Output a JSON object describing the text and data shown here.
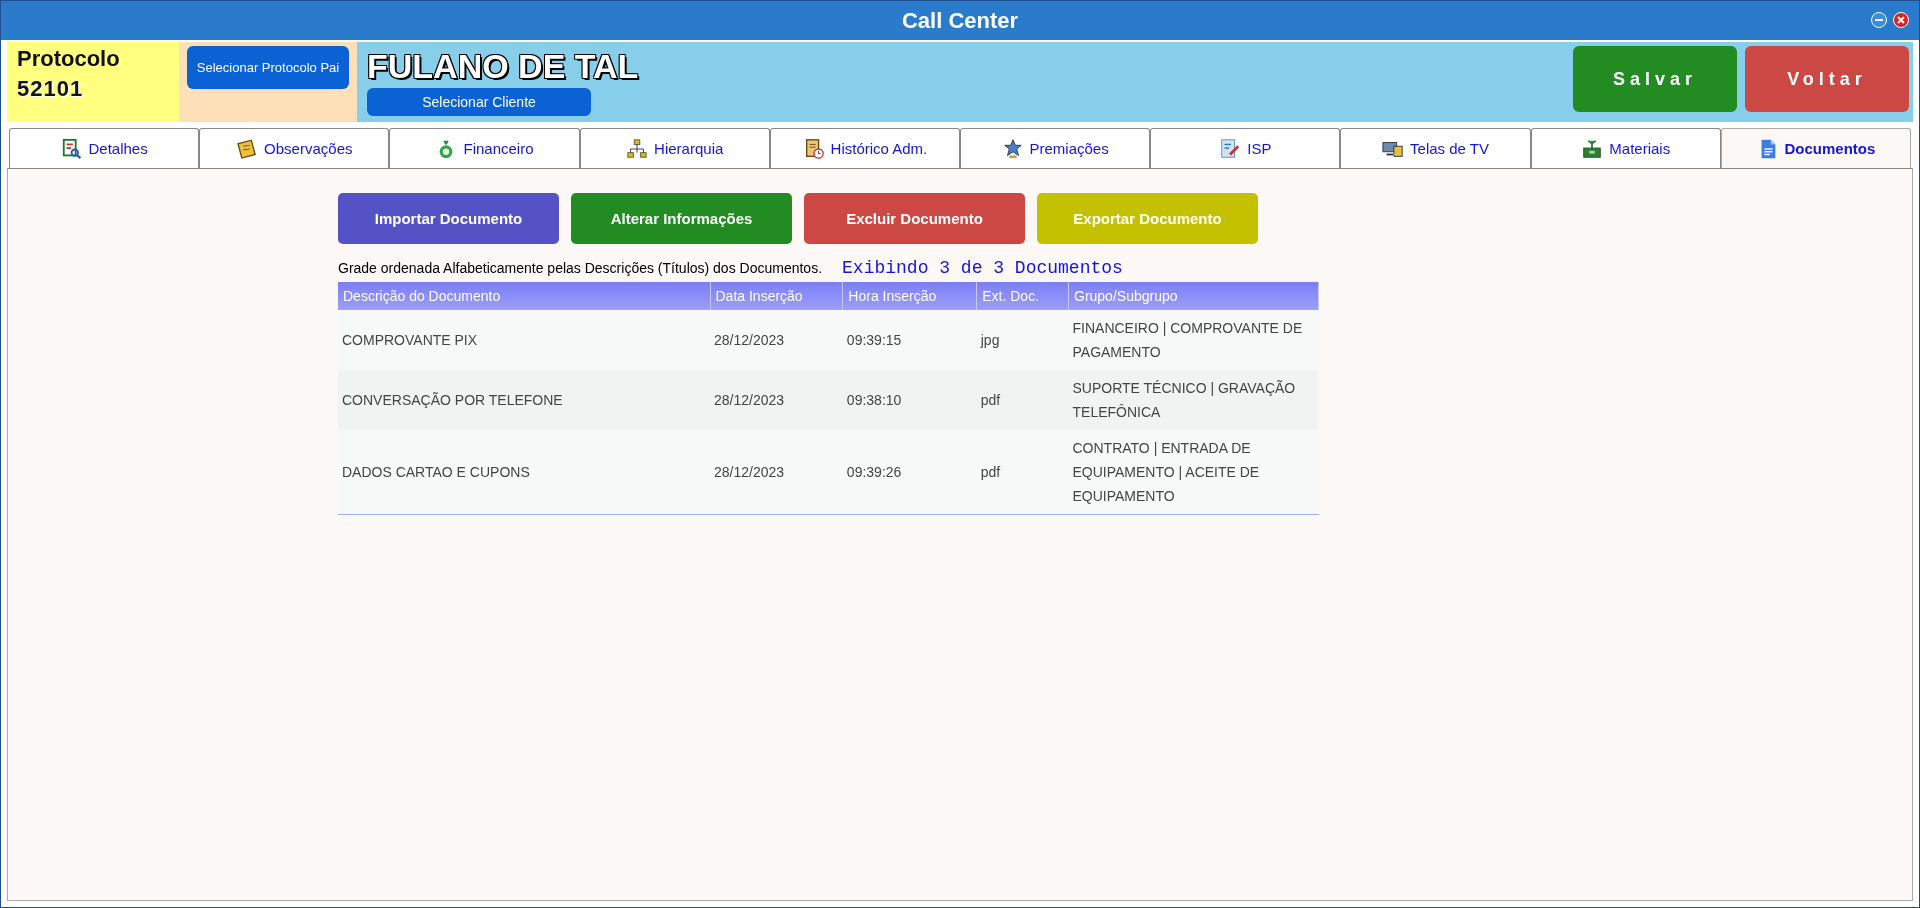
{
  "window": {
    "title": "Call Center"
  },
  "header": {
    "protocol_label": "Protocolo",
    "protocol_number": "52101",
    "select_parent_button": "Selecionar Protocolo Pai",
    "client_name": "FULANO DE TAL",
    "select_client_button": "Selecionar Cliente",
    "save_button": "Salvar",
    "back_button": "Voltar"
  },
  "tabs": [
    {
      "label": "Detalhes",
      "selected": false
    },
    {
      "label": "Observações",
      "selected": false
    },
    {
      "label": "Financeiro",
      "selected": false
    },
    {
      "label": "Hierarquia",
      "selected": false
    },
    {
      "label": "Histórico Adm.",
      "selected": false
    },
    {
      "label": "Premiações",
      "selected": false
    },
    {
      "label": "ISP",
      "selected": false
    },
    {
      "label": "Telas de TV",
      "selected": false
    },
    {
      "label": "Materiais",
      "selected": false
    },
    {
      "label": "Documentos",
      "selected": true
    }
  ],
  "actions": [
    {
      "label": "Importar Documento",
      "color": "#5552c6"
    },
    {
      "label": "Alterar Informações",
      "color": "#228b22"
    },
    {
      "label": "Excluir Documento",
      "color": "#cc4844"
    },
    {
      "label": "Exportar Documento",
      "color": "#c4c200"
    }
  ],
  "caption": "Grade ordenada Alfabeticamente pelas Descrições (Títulos) dos Documentos.",
  "count": "Exibindo 3 de 3 Documentos",
  "table": {
    "columns": [
      "Descrição do Documento",
      "Data Inserção",
      "Hora Inserção",
      "Ext. Doc.",
      "Grupo/Subgrupo"
    ],
    "rows": [
      [
        "COMPROVANTE PIX",
        "28/12/2023",
        "09:39:15",
        "jpg",
        "FINANCEIRO | COMPROVANTE DE PAGAMENTO"
      ],
      [
        "CONVERSAÇÃO POR TELEFONE",
        "28/12/2023",
        "09:38:10",
        "pdf",
        "SUPORTE TÉCNICO | GRAVAÇÃO TELEFÔNICA"
      ],
      [
        "DADOS CARTAO E CUPONS",
        "28/12/2023",
        "09:39:26",
        "pdf",
        "CONTRATO | ENTRADA DE EQUIPAMENTO | ACEITE DE EQUIPAMENTO"
      ]
    ]
  }
}
